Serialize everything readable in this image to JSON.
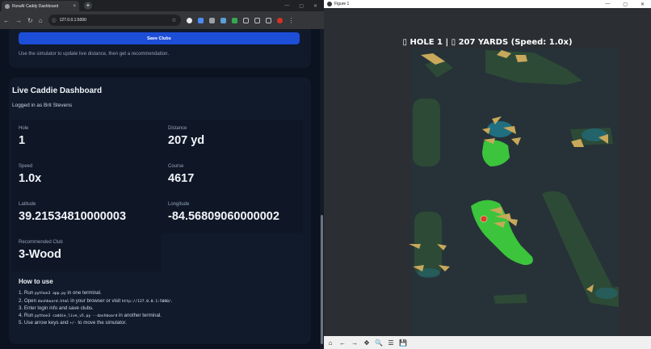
{
  "browser": {
    "tab_title": "RoraAI Caddy Dashboard",
    "url": "127.0.0.1:5000",
    "tab_close_glyph": "×",
    "new_tab_glyph": "+",
    "window_controls": [
      "—",
      "▢",
      "✕"
    ]
  },
  "clubs_card": {
    "save_label": "Save Clubs",
    "hint": "Use the simulator to update live distance, then get a recommendation."
  },
  "dashboard": {
    "title": "Live Caddie Dashboard",
    "logged_in": "Logged in as Brit Stevens",
    "stats": [
      {
        "label": "Hole",
        "value": "1"
      },
      {
        "label": "Distance",
        "value": "207 yd"
      },
      {
        "label": "Speed",
        "value": "1.0x"
      },
      {
        "label": "Course",
        "value": "4617"
      },
      {
        "label": "Latitude",
        "value": "39.21534810000003"
      },
      {
        "label": "Longitude",
        "value": "-84.56809060000002"
      },
      {
        "label": "Recommended Club",
        "value": "3-Wood"
      }
    ],
    "howto_title": "How to use",
    "steps": [
      {
        "pre": "1. Run ",
        "code": "python3 app.py",
        "post": " in one terminal.",
        "code2": "",
        "post2": ""
      },
      {
        "pre": "2. Open ",
        "code": "dashboard.html",
        "post": " in your browser or visit ",
        "code2": "http://127.0.0.1:5000/",
        "post2": "."
      },
      {
        "pre": "3. Enter login info and save clubs.",
        "code": "",
        "post": "",
        "code2": "",
        "post2": ""
      },
      {
        "pre": "4. Run ",
        "code": "python3 caddie_live_v5.py --dashboard",
        "post": " in another terminal.",
        "code2": "",
        "post2": ""
      },
      {
        "pre": "5. Use arrow keys and ",
        "code": "+/-",
        "post": " to move the simulator.",
        "code2": "",
        "post2": ""
      }
    ]
  },
  "figure": {
    "window_title": "Figure 1",
    "overlay": "▯ HOLE 1 | ▯ 207 YARDS (Speed: 1.0x)",
    "window_controls": [
      "—",
      "▢",
      "✕"
    ],
    "toolbar_icons": [
      "⌂",
      "←",
      "→",
      "✥",
      "🔍",
      "☰",
      "💾"
    ],
    "colors": {
      "background": "#2b2e33",
      "rough": "#2d4a36",
      "fairway": "#3cc43c",
      "bunker": "#c8a85a",
      "water": "#1f6f80",
      "ball": "#e03b24"
    }
  }
}
